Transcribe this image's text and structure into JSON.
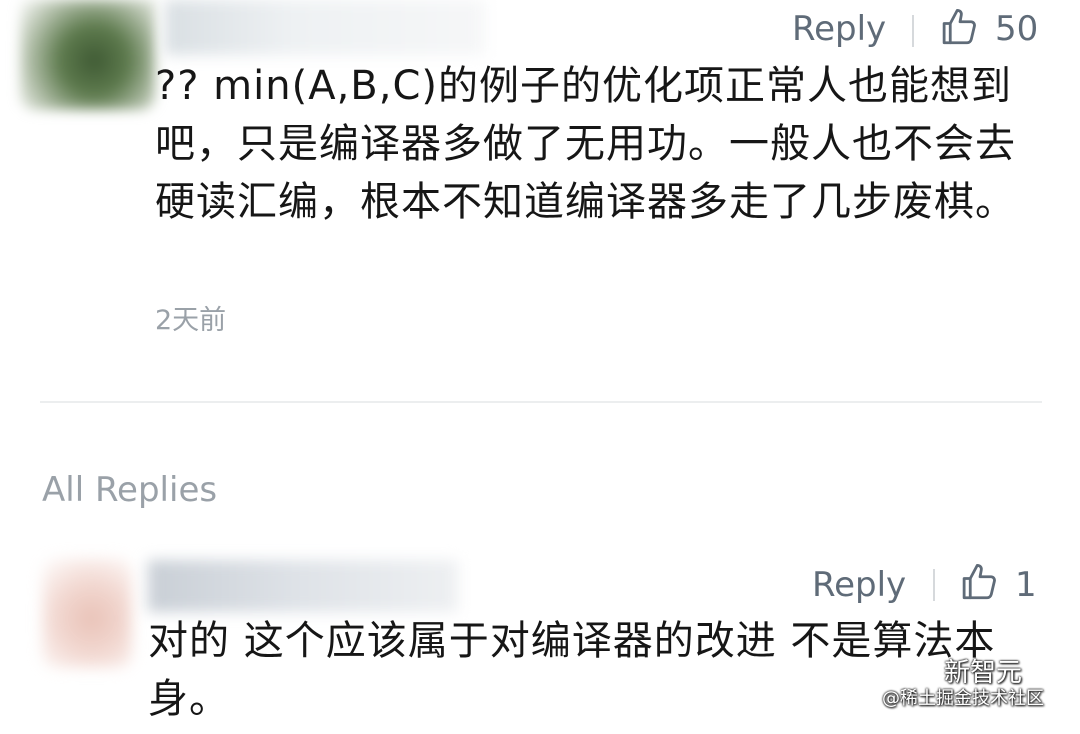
{
  "comment": {
    "reply_label": "Reply",
    "like_count": "50",
    "text": "?? min(A,B,C)的例子的优化项正常人也能想到吧，只是编译器多做了无用功。一般人也不会去硬读汇编，根本不知道编译器多走了几步废棋。",
    "time": "2天前"
  },
  "all_replies": {
    "title": "All Replies"
  },
  "reply": {
    "reply_label": "Reply",
    "like_count": "1",
    "text": "对的 这个应该属于对编译器的改进 不是算法本身。"
  },
  "watermark": {
    "brand": "新智元",
    "sub": "@稀土掘金技术社区"
  },
  "icons": {
    "thumb": "thumbs-up-icon",
    "wechat": "wechat-icon"
  }
}
